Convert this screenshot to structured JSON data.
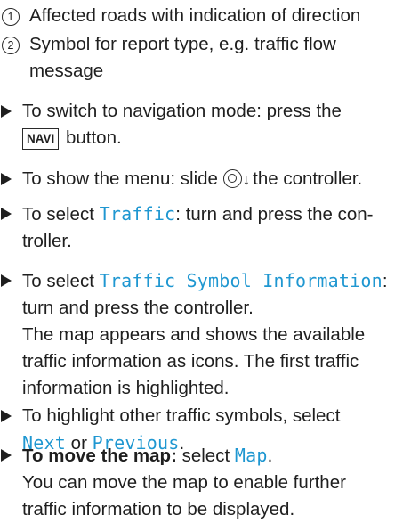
{
  "legend": [
    {
      "num": "1",
      "text": "Affected roads with indication of direction"
    },
    {
      "num": "2",
      "line1": "Symbol for report type, e.g. traffic flow",
      "line2": "message"
    }
  ],
  "steps": {
    "navi": {
      "line1": "To switch to navigation mode: press the",
      "key": "NAVI",
      "after_key": "button."
    },
    "menu": {
      "before": "To show the menu: slide",
      "after": "the controller."
    },
    "traffic": {
      "before": "To select ",
      "item": "Traffic",
      "after": ": turn and press the con-",
      "line2": "troller."
    },
    "symbol_info": {
      "before": "To select ",
      "item": "Traffic Symbol Information",
      "after": ":",
      "lines": [
        "turn and press the controller.",
        "The map appears and shows the available",
        "traffic information as icons. The first traffic",
        "information is highlighted."
      ]
    },
    "highlight": {
      "line1": "To highlight other traffic symbols, select",
      "next": "Next",
      "or": " or ",
      "previous": "Previous",
      "end": "."
    },
    "move_map": {
      "bold": "To move the map:",
      "select": " select ",
      "item": "Map",
      "end": ".",
      "lines": [
        "You can move the map to enable further",
        "traffic information to be displayed."
      ]
    }
  },
  "icons": {
    "controller": "controller-icon",
    "slide_down": "↓"
  }
}
